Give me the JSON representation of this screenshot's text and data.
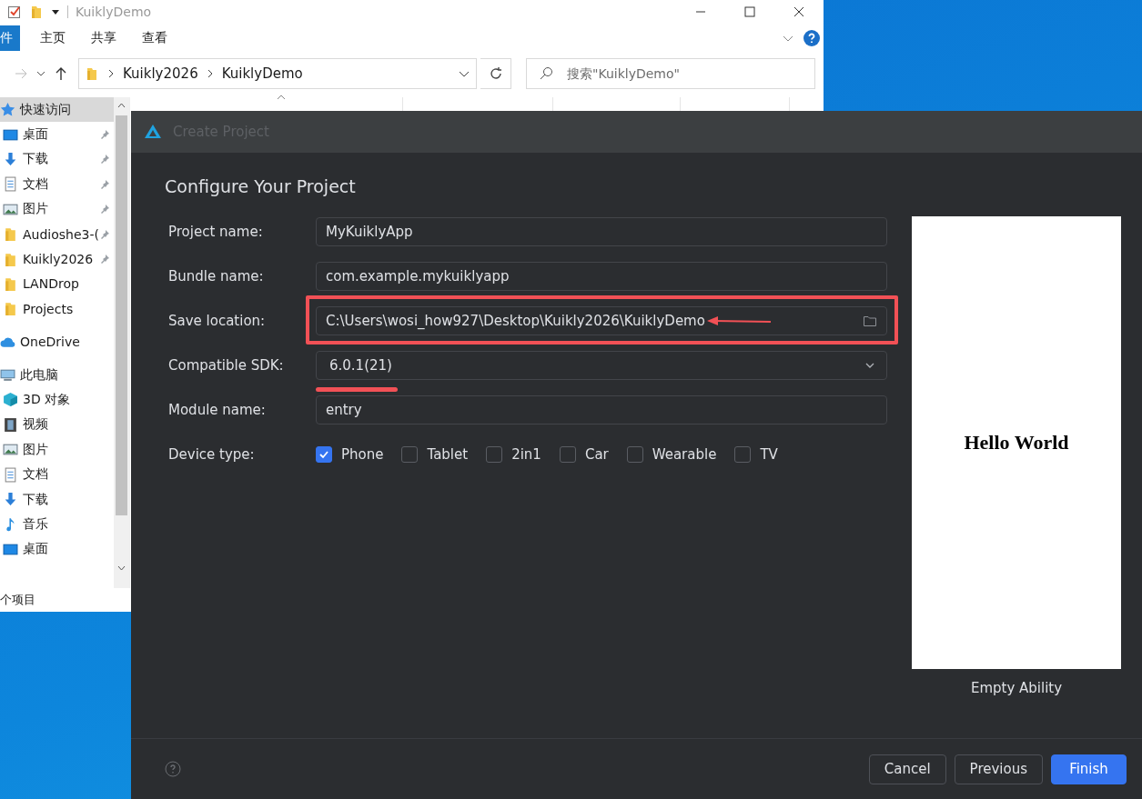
{
  "explorer": {
    "title": "KuiklyDemo",
    "ribbon_tabs": [
      {
        "label": "件",
        "selected": true
      },
      {
        "label": "主页",
        "selected": false
      },
      {
        "label": "共享",
        "selected": false
      },
      {
        "label": "查看",
        "selected": false
      }
    ],
    "path": [
      "Kuikly2026",
      "KuiklyDemo"
    ],
    "search": {
      "placeholder": "搜索\"KuiklyDemo\""
    },
    "nav": [
      {
        "label": "快速访问",
        "kind": "star",
        "selected": true,
        "children": [
          {
            "label": "桌面",
            "kind": "desktop",
            "pinned": true
          },
          {
            "label": "下载",
            "kind": "download",
            "pinned": true
          },
          {
            "label": "文档",
            "kind": "document",
            "pinned": true
          },
          {
            "label": "图片",
            "kind": "picture",
            "pinned": true
          },
          {
            "label": "Audioshe3-(",
            "kind": "folder",
            "pinned": true
          },
          {
            "label": "Kuikly2026",
            "kind": "folder",
            "pinned": true
          },
          {
            "label": "LANDrop",
            "kind": "folder",
            "pinned": false
          },
          {
            "label": "Projects",
            "kind": "folder",
            "pinned": false
          }
        ]
      },
      {
        "label": "OneDrive",
        "kind": "cloud",
        "selected": false
      },
      {
        "label": "此电脑",
        "kind": "pc",
        "selected": false,
        "children": [
          {
            "label": "3D 对象",
            "kind": "cube",
            "pinned": false
          },
          {
            "label": "视频",
            "kind": "video",
            "pinned": false
          },
          {
            "label": "图片",
            "kind": "picture",
            "pinned": false
          },
          {
            "label": "文档",
            "kind": "document",
            "pinned": false
          },
          {
            "label": "下载",
            "kind": "download",
            "pinned": false
          },
          {
            "label": "音乐",
            "kind": "music",
            "pinned": false
          },
          {
            "label": "桌面",
            "kind": "desktop",
            "pinned": false
          }
        ]
      }
    ],
    "status": "个项目"
  },
  "dialog": {
    "title": "Create Project",
    "heading": "Configure Your Project",
    "fields": [
      {
        "label": "Project name:",
        "kind": "text",
        "value": "MyKuiklyApp",
        "boxed": false,
        "underlined": false
      },
      {
        "label": "Bundle name:",
        "kind": "text",
        "value": "com.example.mykuiklyapp",
        "boxed": false,
        "underlined": false
      },
      {
        "label": "Save location:",
        "kind": "folder",
        "value": "C:\\Users\\wosi_how927\\Desktop\\Kuikly2026\\KuiklyDemo",
        "boxed": true,
        "underlined": false
      },
      {
        "label": "Compatible SDK:",
        "kind": "select",
        "value": "6.0.1(21)",
        "boxed": false,
        "underlined": true
      },
      {
        "label": "Module name:",
        "kind": "text",
        "value": "entry",
        "boxed": false,
        "underlined": false
      }
    ],
    "device_type": {
      "label": "Device type:",
      "options": [
        {
          "label": "Phone",
          "checked": true
        },
        {
          "label": "Tablet",
          "checked": false
        },
        {
          "label": "2in1",
          "checked": false
        },
        {
          "label": "Car",
          "checked": false
        },
        {
          "label": "Wearable",
          "checked": false
        },
        {
          "label": "TV",
          "checked": false
        }
      ]
    },
    "preview": {
      "text": "Hello World",
      "caption": "Empty Ability"
    },
    "buttons": [
      {
        "label": "Cancel",
        "kind": "secondary"
      },
      {
        "label": "Previous",
        "kind": "secondary"
      },
      {
        "label": "Finish",
        "kind": "primary"
      }
    ]
  }
}
